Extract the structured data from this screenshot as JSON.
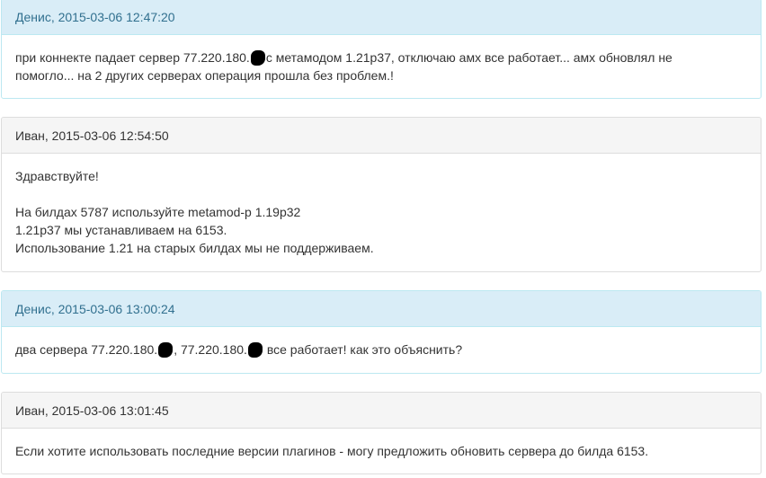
{
  "messages": [
    {
      "heading": "Денис, 2015-03-06 12:47:20",
      "role": "customer",
      "line1_a": "при коннекте падает сервер 77.220.180.",
      "line1_b": "с метамодом 1.21p37, отключаю амх все работает... амх обновлял не",
      "line2": "помогло... на 2 других серверах операция прошла без проблем.!"
    },
    {
      "heading": "Иван, 2015-03-06 12:54:50",
      "role": "staff",
      "line1": "Здравствуйте!",
      "line2": "На билдах 5787 используйте metamod-p 1.19p32",
      "line3": "1.21p37 мы устанавливаем на 6153.",
      "line4": "Использование 1.21 на старых билдах мы не поддерживаем."
    },
    {
      "heading": "Денис, 2015-03-06 13:00:24",
      "role": "customer",
      "line1_a": "два сервера 77.220.180.",
      "line1_b": ", 77.220.180.",
      "line1_c": " все работает! как это объяснить?"
    },
    {
      "heading": "Иван, 2015-03-06 13:01:45",
      "role": "staff",
      "line1": "Если хотите использовать последние версии плагинов - могу предложить обновить сервера до билда 6153."
    }
  ],
  "colors": {
    "customer_heading_bg": "#d9edf7",
    "customer_heading_text": "#31708f",
    "staff_heading_bg": "#f5f5f5",
    "redaction": "#000000"
  },
  "icons": {
    "redaction": "redaction-mark-icon"
  }
}
